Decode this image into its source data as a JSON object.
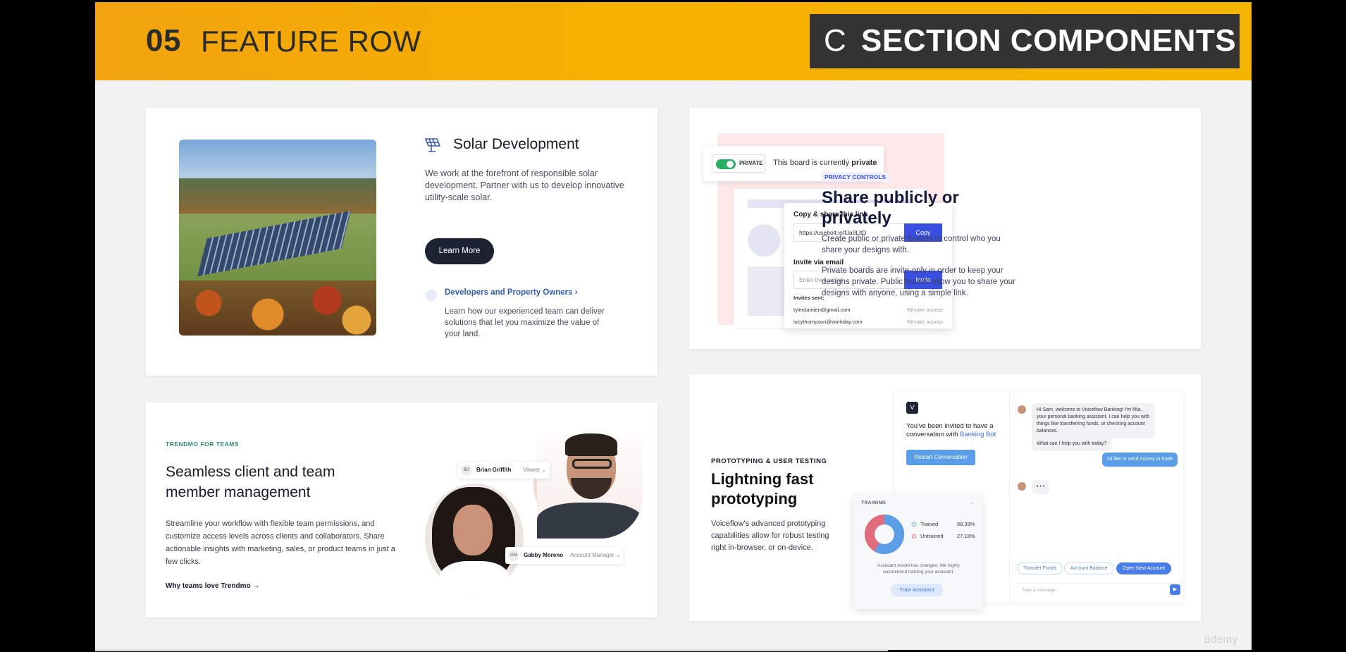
{
  "banner": {
    "number": "05",
    "title": "FEATURE ROW",
    "section_letter": "C",
    "section_label": "SECTION COMPONENTS"
  },
  "solar": {
    "title": "Solar Development",
    "description": "We work at the forefront of responsible solar development. Partner with us to develop innovative utility-scale solar.",
    "button": "Learn More",
    "link": "Developers and Property Owners ›",
    "link_description": "Learn how our experienced team can deliver solutions that let you maximize the value of your land."
  },
  "privacy": {
    "toggle_label": "PRIVATE",
    "toggle_text_prefix": "This board is currently",
    "toggle_text_bold": "private",
    "share_heading": "Copy & share this link",
    "share_url": "https://usebolt.io/fJa9LitD",
    "copy_button": "Copy",
    "invite_heading": "Invite via email",
    "invite_placeholder": "Enter their email",
    "invite_button": "Invite",
    "invites_sent_label": "Invites sent:",
    "invites": [
      {
        "email": "tylerdamien@gmail.com",
        "action": "Revoke access"
      },
      {
        "email": "lucythompson@workday.com",
        "action": "Revoke access"
      }
    ],
    "tag": "PRIVACY CONTROLS",
    "title": "Share publicly or privately",
    "paragraph1": "Create public or private boards to control who you share your designs with.",
    "paragraph2": "Private boards are invite-only in order to keep your designs private. Public boards allow you to share your designs with anyone, using a simple link."
  },
  "trendmo": {
    "tag": "TRENDMO FOR TEAMS",
    "title": "Seamless client and team member management",
    "description": "Streamline your workflow with flexible team permissions, and customize access levels across clients and collaborators. Share actionable insights with marketing, sales, or product teams in just a few clicks.",
    "link": "Why teams love Trendmo →",
    "person1": {
      "initials": "BG",
      "name": "Brian Griffith",
      "role": "Viewer ⌄"
    },
    "person2": {
      "initials": "GM",
      "name": "Gabby Moreno",
      "role": "Account Manager ⌄"
    }
  },
  "voiceflow": {
    "tag": "PROTOTYPING & USER TESTING",
    "title": "Lightning fast prototyping",
    "description": "Voiceflow's advanced prototyping capabilities allow for robust testing right in-browser, or on-device.",
    "logo": "V",
    "invite_prefix": "You've been invited to have a conversation with",
    "invite_bot": "Banking Bot",
    "restart_button": "Restart Conversation",
    "bot_message1": "Hi Sam, welcome to Voiceflow Banking! I'm Mia, your personal banking assistant. I can help you with things like transferring funds, or checking account balances.",
    "bot_message2": "What can I help you with today?",
    "user_message": "I'd like to send money to Katie",
    "typing": "• • •",
    "chips": [
      "Transfer Funds",
      "Account Balance",
      "Open New Account"
    ],
    "message_placeholder": "Type a message...",
    "training_label": "TRAINING",
    "trained_label": "Trained",
    "trained_value": "58.39%",
    "untrained_label": "Untrained",
    "untrained_value": "27.18%",
    "training_note": "Assistant model has changed. We highly recommend training your assistant.",
    "train_button": "Train Assistant"
  },
  "watermark": "ūdemy",
  "colors": {
    "banner": "#f5b000",
    "trained": "#5a9ee8",
    "untrained": "#e06b7c"
  }
}
